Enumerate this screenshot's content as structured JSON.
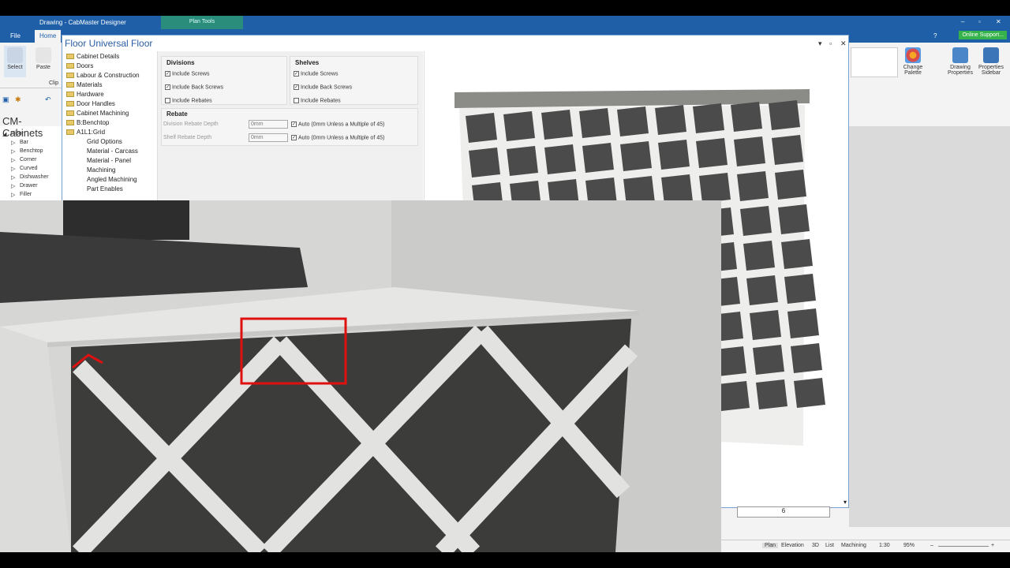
{
  "app": {
    "title": "Drawing - CabMaster Designer",
    "context_tab": "Plan Tools",
    "online_support": "Online Support..."
  },
  "ribbon": {
    "tabs": [
      "File",
      "Home"
    ],
    "active_tab": "Home",
    "buttons": {
      "select": "Select",
      "paste": "Paste",
      "clip_group": "Clip",
      "change_palette": "Change Palette",
      "drawing_properties": "Drawing Properties",
      "properties_sidebar": "Properties Sidebar"
    }
  },
  "left_tree": {
    "title": "CM-Cabinets",
    "root": "Floor",
    "items": [
      "Bar",
      "Benchtop",
      "Corner",
      "Curved",
      "Dishwasher",
      "Drawer",
      "Filler"
    ]
  },
  "dialog": {
    "title": "Floor Universal Floor",
    "tree": [
      {
        "label": "Cabinet Details",
        "folder": true,
        "indent": 0
      },
      {
        "label": "Doors",
        "folder": true,
        "indent": 0
      },
      {
        "label": "Labour & Construction",
        "folder": true,
        "indent": 0
      },
      {
        "label": "Materials",
        "folder": true,
        "indent": 0
      },
      {
        "label": "Hardware",
        "folder": true,
        "indent": 0
      },
      {
        "label": "Door Handles",
        "folder": true,
        "indent": 0
      },
      {
        "label": "Cabinet Machining",
        "folder": true,
        "indent": 0
      },
      {
        "label": "B:Benchtop",
        "folder": true,
        "indent": 0
      },
      {
        "label": "A1L1:Grid",
        "folder": true,
        "indent": 0
      },
      {
        "label": "Grid Options",
        "folder": false,
        "indent": 1
      },
      {
        "label": "Material - Carcass",
        "folder": false,
        "indent": 1
      },
      {
        "label": "Material - Panel",
        "folder": false,
        "indent": 1
      },
      {
        "label": "Machining",
        "folder": false,
        "indent": 1
      },
      {
        "label": "Angled Machining",
        "folder": false,
        "indent": 1
      },
      {
        "label": "Part Enables",
        "folder": false,
        "indent": 1
      }
    ],
    "divisions": {
      "header": "Divisions",
      "include_screws": "Include Screws",
      "include_back_screws": "Include Back Screws",
      "include_rebates": "Include Rebates",
      "checked": [
        true,
        true,
        false
      ]
    },
    "shelves": {
      "header": "Shelves",
      "include_screws": "Include Screws",
      "include_back_screws": "Include Back Screws",
      "include_rebates": "Include Rebates",
      "checked": [
        true,
        true,
        false
      ]
    },
    "rebate": {
      "header": "Rebate",
      "division_label": "Division Rebate Depth",
      "division_value": "0mm",
      "division_auto": "Auto (0mm Unless a Multiple of 45)",
      "shelf_label": "Shelf Rebate Depth",
      "shelf_value": "0mm",
      "shelf_auto": "Auto (0mm Unless a Multiple of 45)"
    }
  },
  "status": {
    "views": [
      "Plan",
      "Elevation",
      "3D",
      "List",
      "Machining"
    ],
    "active_view": "Plan",
    "scale": "1:30",
    "zoom": "95%",
    "cell_value": "6"
  },
  "colors": {
    "title_blue": "#1e5fa8",
    "plan_tools": "#2a8c7a",
    "online_green": "#36b24a",
    "highlight_red": "#e01010"
  }
}
